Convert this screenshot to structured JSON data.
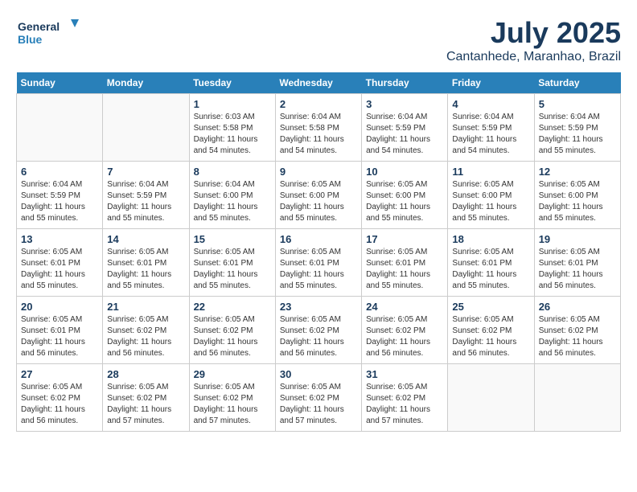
{
  "logo": {
    "line1": "General",
    "line2": "Blue"
  },
  "title": "July 2025",
  "subtitle": "Cantanhede, Maranhao, Brazil",
  "headers": [
    "Sunday",
    "Monday",
    "Tuesday",
    "Wednesday",
    "Thursday",
    "Friday",
    "Saturday"
  ],
  "weeks": [
    [
      {
        "day": "",
        "sunrise": "",
        "sunset": "",
        "daylight": ""
      },
      {
        "day": "",
        "sunrise": "",
        "sunset": "",
        "daylight": ""
      },
      {
        "day": "1",
        "sunrise": "Sunrise: 6:03 AM",
        "sunset": "Sunset: 5:58 PM",
        "daylight": "Daylight: 11 hours and 54 minutes."
      },
      {
        "day": "2",
        "sunrise": "Sunrise: 6:04 AM",
        "sunset": "Sunset: 5:58 PM",
        "daylight": "Daylight: 11 hours and 54 minutes."
      },
      {
        "day": "3",
        "sunrise": "Sunrise: 6:04 AM",
        "sunset": "Sunset: 5:59 PM",
        "daylight": "Daylight: 11 hours and 54 minutes."
      },
      {
        "day": "4",
        "sunrise": "Sunrise: 6:04 AM",
        "sunset": "Sunset: 5:59 PM",
        "daylight": "Daylight: 11 hours and 54 minutes."
      },
      {
        "day": "5",
        "sunrise": "Sunrise: 6:04 AM",
        "sunset": "Sunset: 5:59 PM",
        "daylight": "Daylight: 11 hours and 55 minutes."
      }
    ],
    [
      {
        "day": "6",
        "sunrise": "Sunrise: 6:04 AM",
        "sunset": "Sunset: 5:59 PM",
        "daylight": "Daylight: 11 hours and 55 minutes."
      },
      {
        "day": "7",
        "sunrise": "Sunrise: 6:04 AM",
        "sunset": "Sunset: 5:59 PM",
        "daylight": "Daylight: 11 hours and 55 minutes."
      },
      {
        "day": "8",
        "sunrise": "Sunrise: 6:04 AM",
        "sunset": "Sunset: 6:00 PM",
        "daylight": "Daylight: 11 hours and 55 minutes."
      },
      {
        "day": "9",
        "sunrise": "Sunrise: 6:05 AM",
        "sunset": "Sunset: 6:00 PM",
        "daylight": "Daylight: 11 hours and 55 minutes."
      },
      {
        "day": "10",
        "sunrise": "Sunrise: 6:05 AM",
        "sunset": "Sunset: 6:00 PM",
        "daylight": "Daylight: 11 hours and 55 minutes."
      },
      {
        "day": "11",
        "sunrise": "Sunrise: 6:05 AM",
        "sunset": "Sunset: 6:00 PM",
        "daylight": "Daylight: 11 hours and 55 minutes."
      },
      {
        "day": "12",
        "sunrise": "Sunrise: 6:05 AM",
        "sunset": "Sunset: 6:00 PM",
        "daylight": "Daylight: 11 hours and 55 minutes."
      }
    ],
    [
      {
        "day": "13",
        "sunrise": "Sunrise: 6:05 AM",
        "sunset": "Sunset: 6:01 PM",
        "daylight": "Daylight: 11 hours and 55 minutes."
      },
      {
        "day": "14",
        "sunrise": "Sunrise: 6:05 AM",
        "sunset": "Sunset: 6:01 PM",
        "daylight": "Daylight: 11 hours and 55 minutes."
      },
      {
        "day": "15",
        "sunrise": "Sunrise: 6:05 AM",
        "sunset": "Sunset: 6:01 PM",
        "daylight": "Daylight: 11 hours and 55 minutes."
      },
      {
        "day": "16",
        "sunrise": "Sunrise: 6:05 AM",
        "sunset": "Sunset: 6:01 PM",
        "daylight": "Daylight: 11 hours and 55 minutes."
      },
      {
        "day": "17",
        "sunrise": "Sunrise: 6:05 AM",
        "sunset": "Sunset: 6:01 PM",
        "daylight": "Daylight: 11 hours and 55 minutes."
      },
      {
        "day": "18",
        "sunrise": "Sunrise: 6:05 AM",
        "sunset": "Sunset: 6:01 PM",
        "daylight": "Daylight: 11 hours and 55 minutes."
      },
      {
        "day": "19",
        "sunrise": "Sunrise: 6:05 AM",
        "sunset": "Sunset: 6:01 PM",
        "daylight": "Daylight: 11 hours and 56 minutes."
      }
    ],
    [
      {
        "day": "20",
        "sunrise": "Sunrise: 6:05 AM",
        "sunset": "Sunset: 6:01 PM",
        "daylight": "Daylight: 11 hours and 56 minutes."
      },
      {
        "day": "21",
        "sunrise": "Sunrise: 6:05 AM",
        "sunset": "Sunset: 6:02 PM",
        "daylight": "Daylight: 11 hours and 56 minutes."
      },
      {
        "day": "22",
        "sunrise": "Sunrise: 6:05 AM",
        "sunset": "Sunset: 6:02 PM",
        "daylight": "Daylight: 11 hours and 56 minutes."
      },
      {
        "day": "23",
        "sunrise": "Sunrise: 6:05 AM",
        "sunset": "Sunset: 6:02 PM",
        "daylight": "Daylight: 11 hours and 56 minutes."
      },
      {
        "day": "24",
        "sunrise": "Sunrise: 6:05 AM",
        "sunset": "Sunset: 6:02 PM",
        "daylight": "Daylight: 11 hours and 56 minutes."
      },
      {
        "day": "25",
        "sunrise": "Sunrise: 6:05 AM",
        "sunset": "Sunset: 6:02 PM",
        "daylight": "Daylight: 11 hours and 56 minutes."
      },
      {
        "day": "26",
        "sunrise": "Sunrise: 6:05 AM",
        "sunset": "Sunset: 6:02 PM",
        "daylight": "Daylight: 11 hours and 56 minutes."
      }
    ],
    [
      {
        "day": "27",
        "sunrise": "Sunrise: 6:05 AM",
        "sunset": "Sunset: 6:02 PM",
        "daylight": "Daylight: 11 hours and 56 minutes."
      },
      {
        "day": "28",
        "sunrise": "Sunrise: 6:05 AM",
        "sunset": "Sunset: 6:02 PM",
        "daylight": "Daylight: 11 hours and 57 minutes."
      },
      {
        "day": "29",
        "sunrise": "Sunrise: 6:05 AM",
        "sunset": "Sunset: 6:02 PM",
        "daylight": "Daylight: 11 hours and 57 minutes."
      },
      {
        "day": "30",
        "sunrise": "Sunrise: 6:05 AM",
        "sunset": "Sunset: 6:02 PM",
        "daylight": "Daylight: 11 hours and 57 minutes."
      },
      {
        "day": "31",
        "sunrise": "Sunrise: 6:05 AM",
        "sunset": "Sunset: 6:02 PM",
        "daylight": "Daylight: 11 hours and 57 minutes."
      },
      {
        "day": "",
        "sunrise": "",
        "sunset": "",
        "daylight": ""
      },
      {
        "day": "",
        "sunrise": "",
        "sunset": "",
        "daylight": ""
      }
    ]
  ]
}
